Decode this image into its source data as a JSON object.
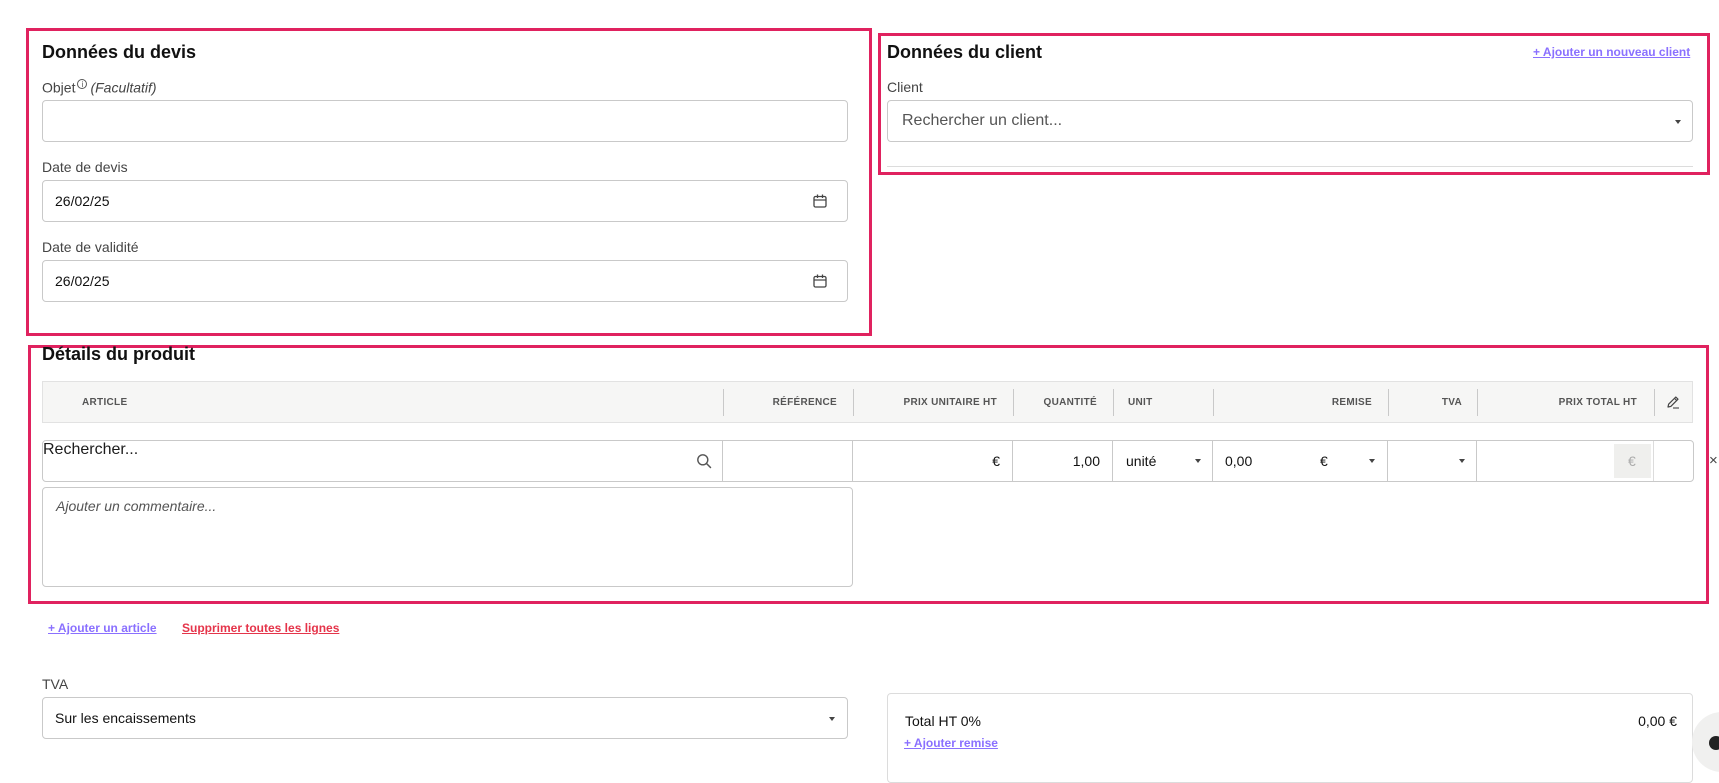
{
  "quote": {
    "title": "Données du devis",
    "object_label": "Objet",
    "object_optional": "(Facultatif)",
    "object_value": "",
    "date_label": "Date de devis",
    "date_value": "26/02/25",
    "validity_label": "Date de validité",
    "validity_value": "26/02/25"
  },
  "client": {
    "title": "Données du client",
    "add_link": "+ Ajouter un nouveau client",
    "client_label": "Client",
    "search_placeholder": "Rechercher un client..."
  },
  "product": {
    "title": "Détails du produit",
    "columns": {
      "article": "ARTICLE",
      "reference": "RÉFÉRENCE",
      "unit_price": "PRIX UNITAIRE HT",
      "quantity": "QUANTITÉ",
      "unit": "UNIT",
      "discount": "REMISE",
      "vat": "TVA",
      "total": "PRIX TOTAL HT"
    },
    "row": {
      "search_placeholder": "Rechercher...",
      "reference": "",
      "price_currency": "€",
      "quantity": "1,00",
      "unit": "unité",
      "discount": "0,00",
      "discount_currency": "€",
      "vat": "",
      "total_currency": "€",
      "comment_placeholder": "Ajouter un commentaire..."
    },
    "add_article_link": "+ Ajouter un article",
    "delete_all_link": "Supprimer toutes les lignes"
  },
  "vat": {
    "label": "TVA",
    "selected": "Sur les encaissements"
  },
  "totals": {
    "total_ht_label": "Total HT 0%",
    "total_ht_value": "0,00 €",
    "add_discount_link": "+ Ajouter remise"
  },
  "colors": {
    "highlight": "#e0225f",
    "link": "#8a70ff",
    "danger": "#e5344a"
  }
}
